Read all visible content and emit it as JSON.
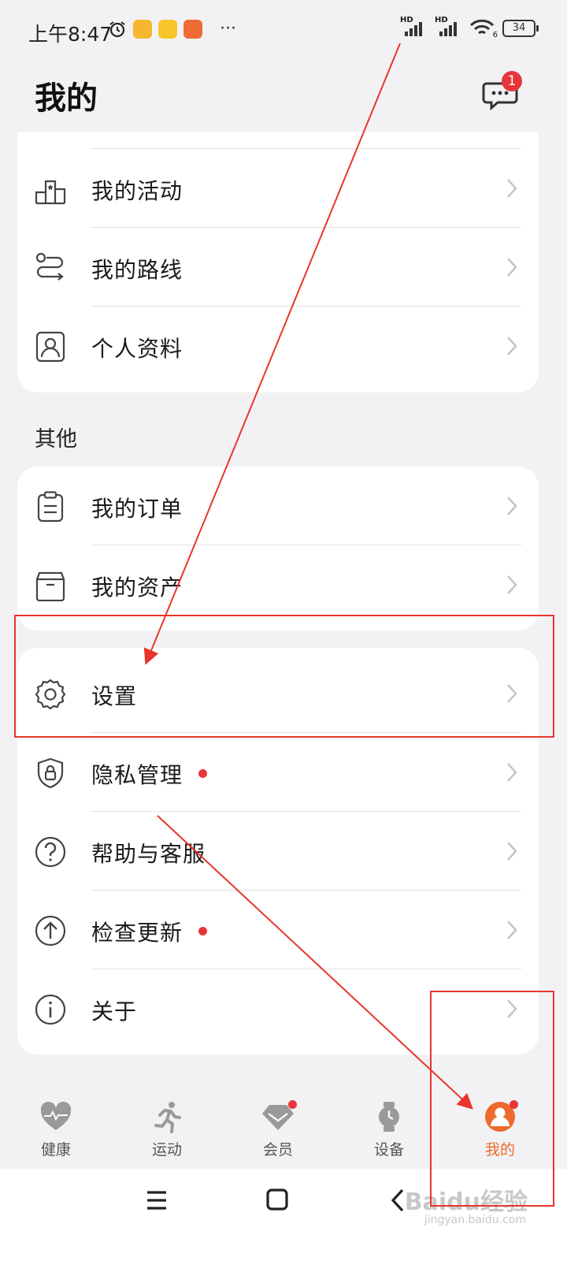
{
  "status_bar": {
    "time": "上午8:47",
    "more": "···",
    "signal_label_1": "HD",
    "signal_label_2": "HD",
    "wifi_label": "6",
    "battery": "34"
  },
  "header": {
    "title": "我的",
    "message_badge": "1"
  },
  "card_top": {
    "items": [
      {
        "label": "我的活动",
        "icon": "podium-icon"
      },
      {
        "label": "我的路线",
        "icon": "route-icon"
      },
      {
        "label": "个人资料",
        "icon": "profile-card-icon"
      }
    ]
  },
  "section_other": {
    "title": "其他",
    "items": [
      {
        "label": "我的订单",
        "icon": "clipboard-icon"
      },
      {
        "label": "我的资产",
        "icon": "box-icon"
      }
    ]
  },
  "card_settings": {
    "items": [
      {
        "label": "设置",
        "icon": "gear-icon"
      },
      {
        "label": "隐私管理",
        "icon": "shield-lock-icon",
        "dot": true
      },
      {
        "label": "帮助与客服",
        "icon": "question-icon"
      },
      {
        "label": "检查更新",
        "icon": "upload-arrow-icon",
        "dot": true
      },
      {
        "label": "关于",
        "icon": "info-icon"
      }
    ]
  },
  "bottom_nav": {
    "items": [
      {
        "label": "健康",
        "icon": "heart-pulse-icon"
      },
      {
        "label": "运动",
        "icon": "runner-icon"
      },
      {
        "label": "会员",
        "icon": "diamond-icon",
        "dot": true
      },
      {
        "label": "设备",
        "icon": "watch-icon"
      },
      {
        "label": "我的",
        "icon": "user-avatar-icon",
        "active": true,
        "dot": true
      }
    ]
  },
  "watermark": {
    "text": "Baidu经验",
    "sub": "jingyan.baidu.com"
  },
  "colors": {
    "accent": "#ec6a2c",
    "badge_red": "#e8353c",
    "annotation_red": "#e8352c"
  }
}
